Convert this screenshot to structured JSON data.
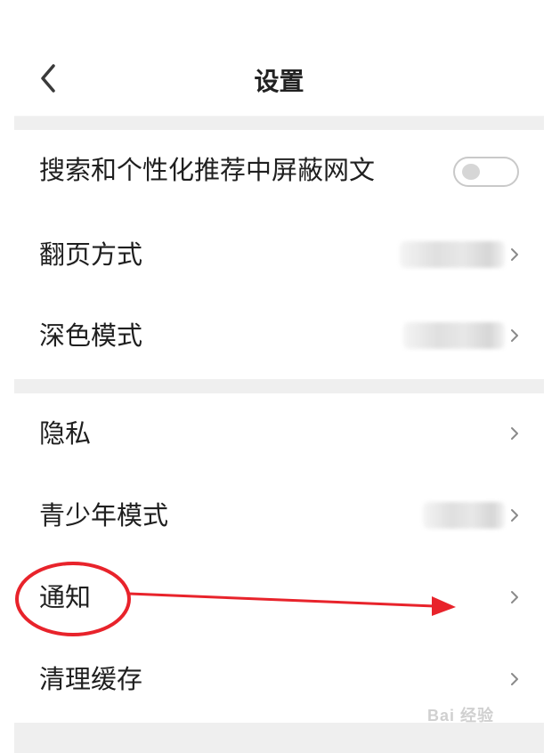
{
  "header": {
    "title": "设置",
    "back_icon": "chevron-left-icon"
  },
  "groups": [
    {
      "items": [
        {
          "label": "搜索和个性化推荐中屏蔽网文",
          "control": "toggle",
          "toggle_on": false
        },
        {
          "label": "翻页方式",
          "control": "chevron",
          "value_blurred": true
        },
        {
          "label": "深色模式",
          "control": "chevron",
          "value_blurred": true
        }
      ]
    },
    {
      "items": [
        {
          "label": "隐私",
          "control": "chevron"
        },
        {
          "label": "青少年模式",
          "control": "chevron",
          "value_blurred": true
        },
        {
          "label": "通知",
          "control": "chevron",
          "annotated": true
        },
        {
          "label": "清理缓存",
          "control": "chevron"
        }
      ]
    }
  ],
  "annotation": {
    "color": "#e8232b",
    "shape": "red circle around 通知 with arrow pointing right"
  },
  "watermark": {
    "text": "Bai 经验"
  },
  "colors": {
    "page_bg": "#ffffff",
    "group_gap": "#efefef",
    "text": "#1f1f1f",
    "chevron": "#8a8a8a"
  }
}
